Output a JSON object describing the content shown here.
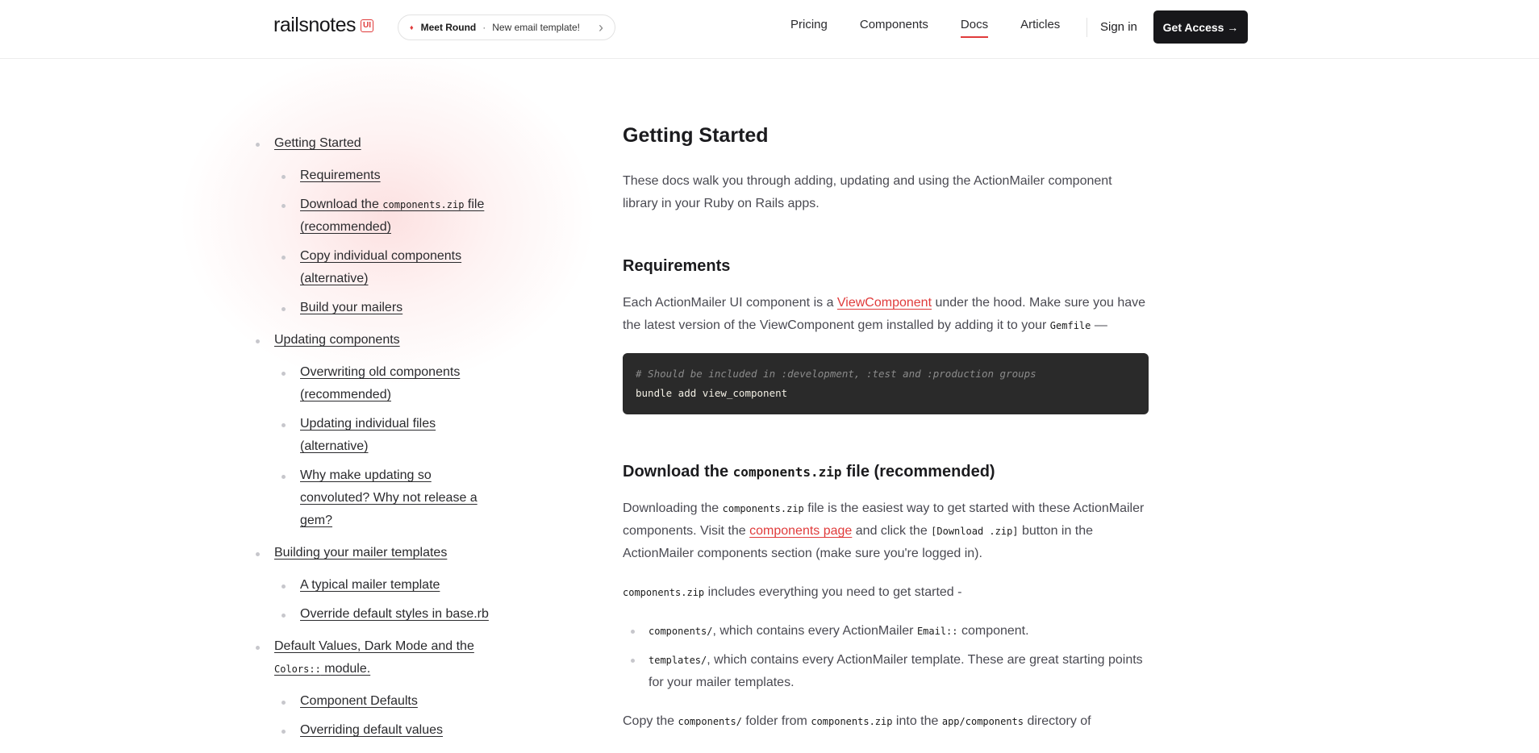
{
  "header": {
    "logo_text": "railsnotes",
    "logo_badge": "UI",
    "announcement": {
      "highlight": "Meet Round",
      "separator": "·",
      "text": "New email template!"
    },
    "nav": [
      "Pricing",
      "Components",
      "Docs",
      "Articles"
    ],
    "active_nav": "Docs",
    "sign_in": "Sign in",
    "cta": "Get Access →"
  },
  "colors": {
    "accent": "#e03b3b",
    "dark": "#17171a",
    "code_bg": "#2a2a2a"
  },
  "sidebar": {
    "sections": [
      {
        "label": "Getting Started",
        "children": [
          {
            "label": "Requirements"
          },
          {
            "pre": "Download the ",
            "code": "components.zip",
            "post": " file (recommended)"
          },
          {
            "label": "Copy individual components (alternative)"
          },
          {
            "label": "Build your mailers"
          }
        ]
      },
      {
        "label": "Updating components",
        "children": [
          {
            "label": "Overwriting old components (recommended)"
          },
          {
            "label": "Updating individual files (alternative)"
          },
          {
            "label": "Why make updating so convoluted? Why not release a gem?"
          }
        ]
      },
      {
        "label": "Building your mailer templates",
        "children": [
          {
            "label": "A typical mailer template"
          },
          {
            "label": "Override default styles in base.rb"
          }
        ]
      },
      {
        "pre": "Default Values, Dark Mode and the ",
        "code": "Colors::",
        "post": " module.",
        "children": [
          {
            "label": "Component Defaults"
          },
          {
            "label": "Overriding default values"
          }
        ]
      }
    ]
  },
  "content": {
    "title": "Getting Started",
    "intro": "These docs walk you through adding, updating and using the ActionMailer component library in your Ruby on Rails apps.",
    "requirements": {
      "heading": "Requirements",
      "p1": "Each ActionMailer UI component is a ",
      "link": "ViewComponent",
      "p2": " under the hood. Make sure you have the latest version of the ViewComponent gem installed by adding it to your ",
      "code": "Gemfile",
      "p3": " —"
    },
    "codeblock": {
      "comment": "# Should be included in :development, :test and :production groups",
      "command": "bundle add view_component"
    },
    "download": {
      "heading_pre": "Download the ",
      "heading_code": "components.zip",
      "heading_post": " file (recommended)",
      "p1_a": "Downloading the ",
      "p1_code": "components.zip",
      "p1_b": " file is the easiest way to get started with these ActionMailer components. Visit the ",
      "p1_link": "components page",
      "p1_c": " and click the ",
      "p1_code2": "[Download .zip]",
      "p1_d": " button in the ActionMailer components section (make sure you're logged in).",
      "p2_code": "components.zip",
      "p2_text": " includes everything you need to get started -",
      "bullets": [
        {
          "code": "components/",
          "text_a": ", which contains every ActionMailer ",
          "code2": "Email::",
          "text_b": " component."
        },
        {
          "code": "templates/",
          "text_a": ", which contains every ActionMailer template. These are great starting points for your mailer templates.",
          "code2": "",
          "text_b": ""
        }
      ],
      "p3_a": "Copy the ",
      "p3_code": "components/",
      "p3_b": " folder from ",
      "p3_code2": "components.zip",
      "p3_c": " into the ",
      "p3_code3": "app/components",
      "p3_d": " directory of"
    }
  }
}
